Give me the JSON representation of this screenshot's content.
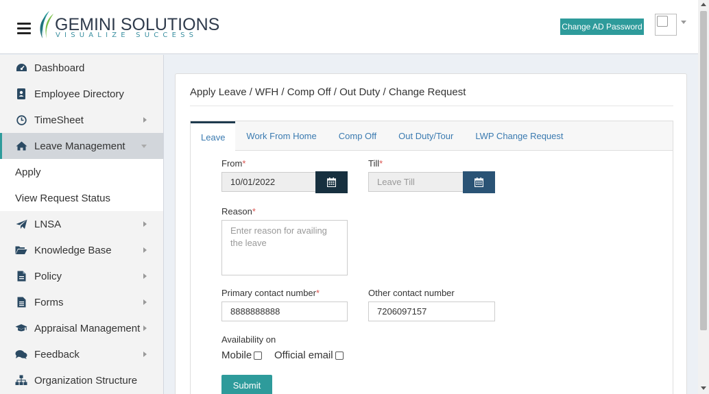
{
  "header": {
    "logo_name": "GEMINI SOLUTIONS",
    "logo_tagline": "VISUALIZE SUCCESS",
    "change_password_label": "Change AD Password",
    "accent_color": "#2e9b9b"
  },
  "sidebar": {
    "items": [
      {
        "label": "Dashboard",
        "icon": "dashboard-icon",
        "has_arrow": false
      },
      {
        "label": "Employee Directory",
        "icon": "address-book-icon",
        "has_arrow": false
      },
      {
        "label": "TimeSheet",
        "icon": "clock-icon",
        "has_arrow": true
      },
      {
        "label": "Leave Management",
        "icon": "home-icon",
        "has_arrow": true,
        "active": true
      },
      {
        "label": "LNSA",
        "icon": "paper-plane-icon",
        "has_arrow": true
      },
      {
        "label": "Knowledge Base",
        "icon": "folder-open-icon",
        "has_arrow": true
      },
      {
        "label": "Policy",
        "icon": "file-icon",
        "has_arrow": true
      },
      {
        "label": "Forms",
        "icon": "file-text-icon",
        "has_arrow": true
      },
      {
        "label": "Appraisal Management",
        "icon": "graduation-cap-icon",
        "has_arrow": true
      },
      {
        "label": "Feedback",
        "icon": "comments-icon",
        "has_arrow": true
      },
      {
        "label": "Organization Structure",
        "icon": "sitemap-icon",
        "has_arrow": false
      }
    ],
    "subitems": [
      {
        "label": "Apply"
      },
      {
        "label": "View Request Status"
      }
    ]
  },
  "main": {
    "title": "Apply Leave / WFH / Comp Off / Out Duty / Change Request",
    "tabs": [
      {
        "label": "Leave",
        "active": true
      },
      {
        "label": "Work From Home"
      },
      {
        "label": "Comp Off"
      },
      {
        "label": "Out Duty/Tour"
      },
      {
        "label": "LWP Change Request"
      }
    ],
    "form": {
      "from_label": "From",
      "from_value": "10/01/2022",
      "till_label": "Till",
      "till_placeholder": "Leave Till",
      "reason_label": "Reason",
      "reason_placeholder": "Enter reason for availing the leave",
      "primary_label": "Primary contact number",
      "primary_value": "8888888888",
      "other_label": "Other contact number",
      "other_value": "7206097157",
      "availability_label": "Availability on",
      "mobile_label": "Mobile",
      "email_label": "Official email",
      "submit_label": "Submit",
      "required_mark": "*"
    },
    "colors": {
      "calendar_from": "#17303f",
      "calendar_till": "#2a5375",
      "tab_text": "#3a7ab0"
    }
  }
}
